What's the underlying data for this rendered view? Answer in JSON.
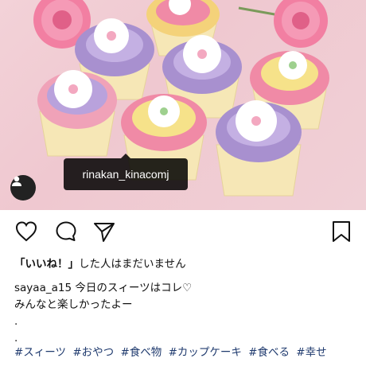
{
  "post": {
    "tagged_user": "rinakan_kinacomj",
    "likes_prefix": "「いいね！」",
    "likes_suffix": "した人はまだいません",
    "username": "sayaa_a15",
    "caption_line1": "今日のスィーツはコレ♡",
    "caption_line2": "みんなと楽しかったよー",
    "caption_dot1": ".",
    "caption_dot2": ".",
    "hashtags": [
      "#スィーツ",
      "#おやつ",
      "#食べ物",
      "#カップケーキ",
      "#食べる",
      "#幸せ"
    ]
  },
  "actions": {
    "like_icon": "heart-icon",
    "comment_icon": "comment-icon",
    "share_icon": "paper-plane-icon",
    "save_icon": "bookmark-icon"
  },
  "colors": {
    "background": "#ffffff",
    "hashtag": "#1f3a6e",
    "tag_bubble": "#111111",
    "photo_bg": "#f0cdd4"
  }
}
